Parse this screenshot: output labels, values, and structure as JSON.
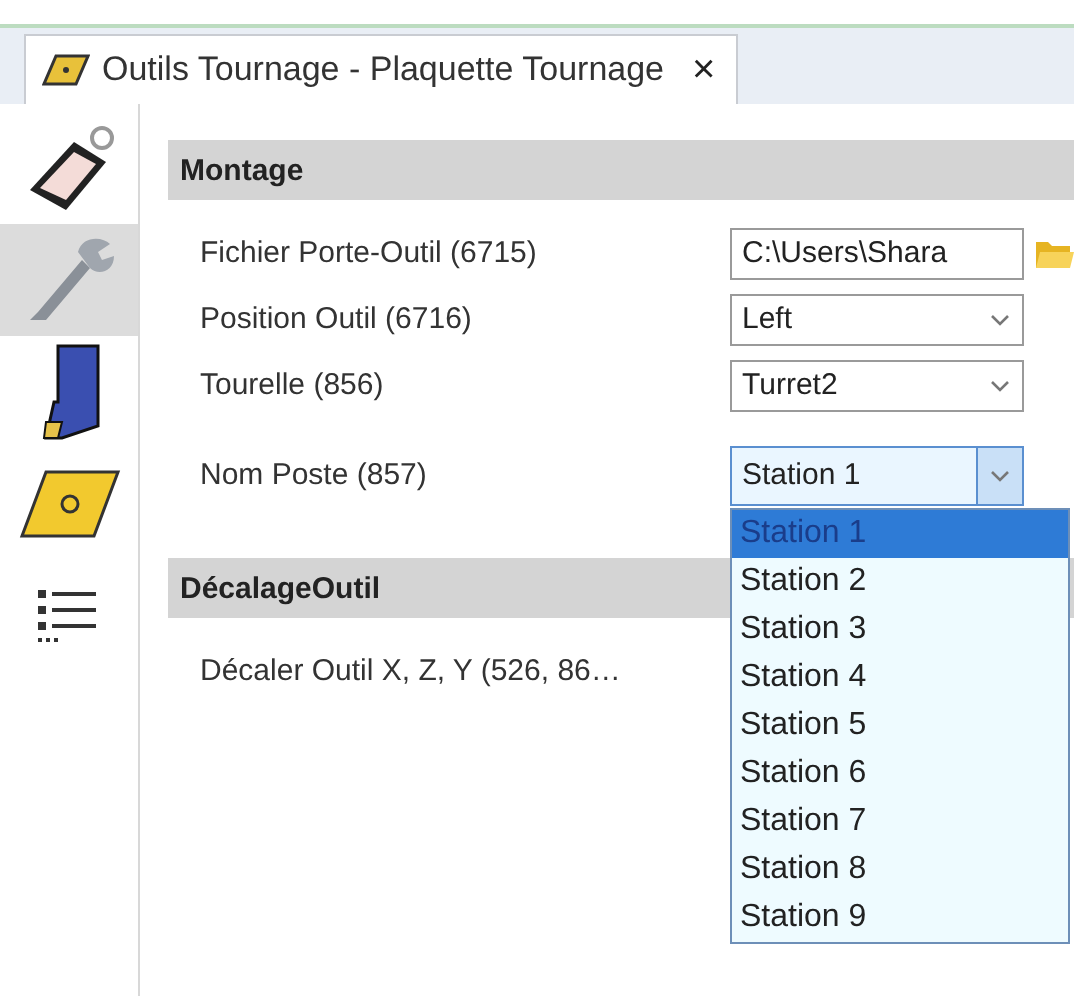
{
  "tab": {
    "title": "Outils Tournage - Plaquette Tournage",
    "close": "×",
    "selected": true
  },
  "sidebar": {
    "items": [
      {
        "kind": "tag",
        "selected": false
      },
      {
        "kind": "wrench",
        "selected": true
      },
      {
        "kind": "holder",
        "selected": false
      },
      {
        "kind": "insert",
        "selected": false
      },
      {
        "kind": "numbering",
        "selected": false
      }
    ]
  },
  "sections": [
    {
      "title": "Montage",
      "rows": [
        {
          "label": "Fichier Porte-Outil (6715)",
          "kind": "file",
          "value": "C:\\Users\\Shara"
        },
        {
          "label": "Position Outil (6716)",
          "kind": "combo",
          "value": "Left",
          "open": false
        },
        {
          "label": "Tourelle (856)",
          "kind": "combo",
          "value": "Turret2",
          "open": false
        },
        {
          "label": "Nom Poste (857)",
          "kind": "combo",
          "value": "Station 1",
          "open": true,
          "options": [
            {
              "label": "Station 1",
              "selected": true
            },
            {
              "label": "Station 2",
              "selected": false
            },
            {
              "label": "Station 3",
              "selected": false
            },
            {
              "label": "Station 4",
              "selected": false
            },
            {
              "label": "Station 5",
              "selected": false
            },
            {
              "label": "Station 6",
              "selected": false
            },
            {
              "label": "Station 7",
              "selected": false
            },
            {
              "label": "Station 8",
              "selected": false
            },
            {
              "label": "Station 9",
              "selected": false
            }
          ]
        }
      ]
    },
    {
      "title": "DécalageOutil",
      "rows": [
        {
          "label": "Décaler Outil X, Z, Y (526, 86…",
          "kind": "text"
        }
      ]
    }
  ]
}
